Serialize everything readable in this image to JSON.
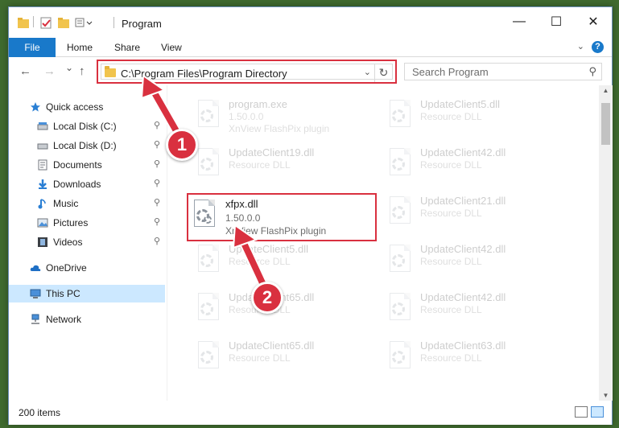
{
  "window": {
    "title": "Program",
    "minimize": "—",
    "maximize": "☐",
    "close": "✕"
  },
  "ribbon": {
    "file": "File",
    "home": "Home",
    "share": "Share",
    "view": "View",
    "help": "?"
  },
  "nav": {
    "back": "←",
    "forward": "→",
    "recent": "⌄",
    "up": "↑",
    "address": "C:\\Program Files\\Program Directory",
    "refresh": "↻",
    "dropdown": "⌄",
    "search_placeholder": "Search Program",
    "search_icon": "⚲"
  },
  "sidebar": {
    "items": [
      {
        "label": "Quick access",
        "icon": "star-icon"
      },
      {
        "label": "Local Disk (C:)",
        "icon": "drive-icon",
        "pinned": true
      },
      {
        "label": "Local Disk (D:)",
        "icon": "drive-icon",
        "pinned": true
      },
      {
        "label": "Documents",
        "icon": "documents-icon",
        "pinned": true
      },
      {
        "label": "Downloads",
        "icon": "downloads-icon",
        "pinned": true
      },
      {
        "label": "Music",
        "icon": "music-icon",
        "pinned": true
      },
      {
        "label": "Pictures",
        "icon": "pictures-icon",
        "pinned": true
      },
      {
        "label": "Videos",
        "icon": "videos-icon",
        "pinned": true
      },
      {
        "label": "OneDrive",
        "icon": "cloud-icon"
      },
      {
        "label": "This PC",
        "icon": "computer-icon",
        "selected": true
      },
      {
        "label": "Network",
        "icon": "network-icon"
      }
    ],
    "pin_glyph": "📌"
  },
  "files": [
    {
      "name": "program.exe",
      "meta": "1.50.0.0",
      "meta2": "XnView FlashPix plugin"
    },
    {
      "name": "UpdateClient5.dll",
      "meta": "Resource DLL"
    },
    {
      "name": "UpdateClient19.dll",
      "meta": "Resource DLL"
    },
    {
      "name": "UpdateClient42.dll",
      "meta": "Resource DLL"
    },
    {
      "name": "xfpx.dll",
      "meta": "1.50.0.0",
      "meta2": "XnView FlashPix plugin"
    },
    {
      "name": "UpdateClient21.dll",
      "meta": "Resource DLL"
    },
    {
      "name": "UpdateClient5.dll",
      "meta": "Resource DLL"
    },
    {
      "name": "UpdateClient42.dll",
      "meta": "Resource DLL"
    },
    {
      "name": "UpdateClient65.dll",
      "meta": "Resource DLL"
    },
    {
      "name": "UpdateClient42.dll",
      "meta": "Resource DLL"
    },
    {
      "name": "UpdateClient65.dll",
      "meta": "Resource DLL"
    },
    {
      "name": "UpdateClient63.dll",
      "meta": "Resource DLL"
    }
  ],
  "status": {
    "count": "200 items"
  },
  "callouts": {
    "one": "1",
    "two": "2"
  },
  "colors": {
    "accent": "#1979ca",
    "highlight": "#d9303f",
    "selected": "#cce8ff"
  }
}
